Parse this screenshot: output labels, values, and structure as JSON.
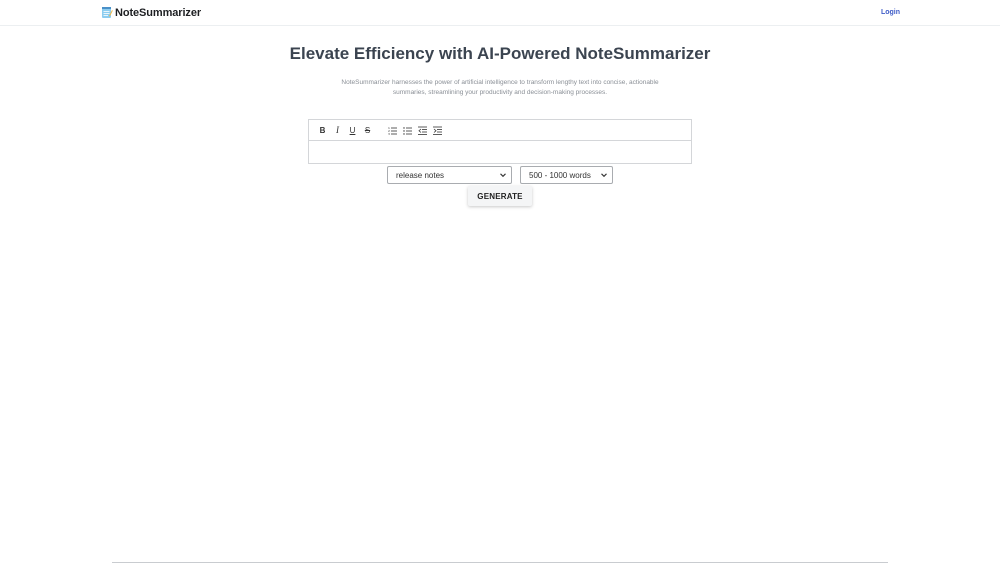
{
  "header": {
    "brand_name": "NoteSummarizer",
    "brand_icon": "notepad-icon",
    "login_label": "Login",
    "accent_color": "#3d5bc7"
  },
  "main": {
    "title": "Elevate Efficiency with AI-Powered NoteSummarizer",
    "description": "NoteSummarizer harnesses the power of artificial intelligence to transform lengthy text into concise, actionable summaries, streamlining your productivity and decision-making processes.",
    "editor": {
      "toolbar": [
        {
          "name": "bold",
          "icon": "bold-icon",
          "glyph": "B"
        },
        {
          "name": "italic",
          "icon": "italic-icon",
          "glyph": "I"
        },
        {
          "name": "underline",
          "icon": "underline-icon",
          "glyph": "U"
        },
        {
          "name": "strikethrough",
          "icon": "strikethrough-icon",
          "glyph": "S"
        },
        {
          "name": "ordered-list",
          "icon": "ordered-list-icon"
        },
        {
          "name": "bullet-list",
          "icon": "bullet-list-icon"
        },
        {
          "name": "outdent",
          "icon": "outdent-icon"
        },
        {
          "name": "indent",
          "icon": "indent-icon"
        }
      ],
      "content": ""
    },
    "note_type_select": {
      "value": "release notes"
    },
    "length_select": {
      "value": "500 - 1000 words"
    },
    "generate_label": "GENERATE"
  }
}
